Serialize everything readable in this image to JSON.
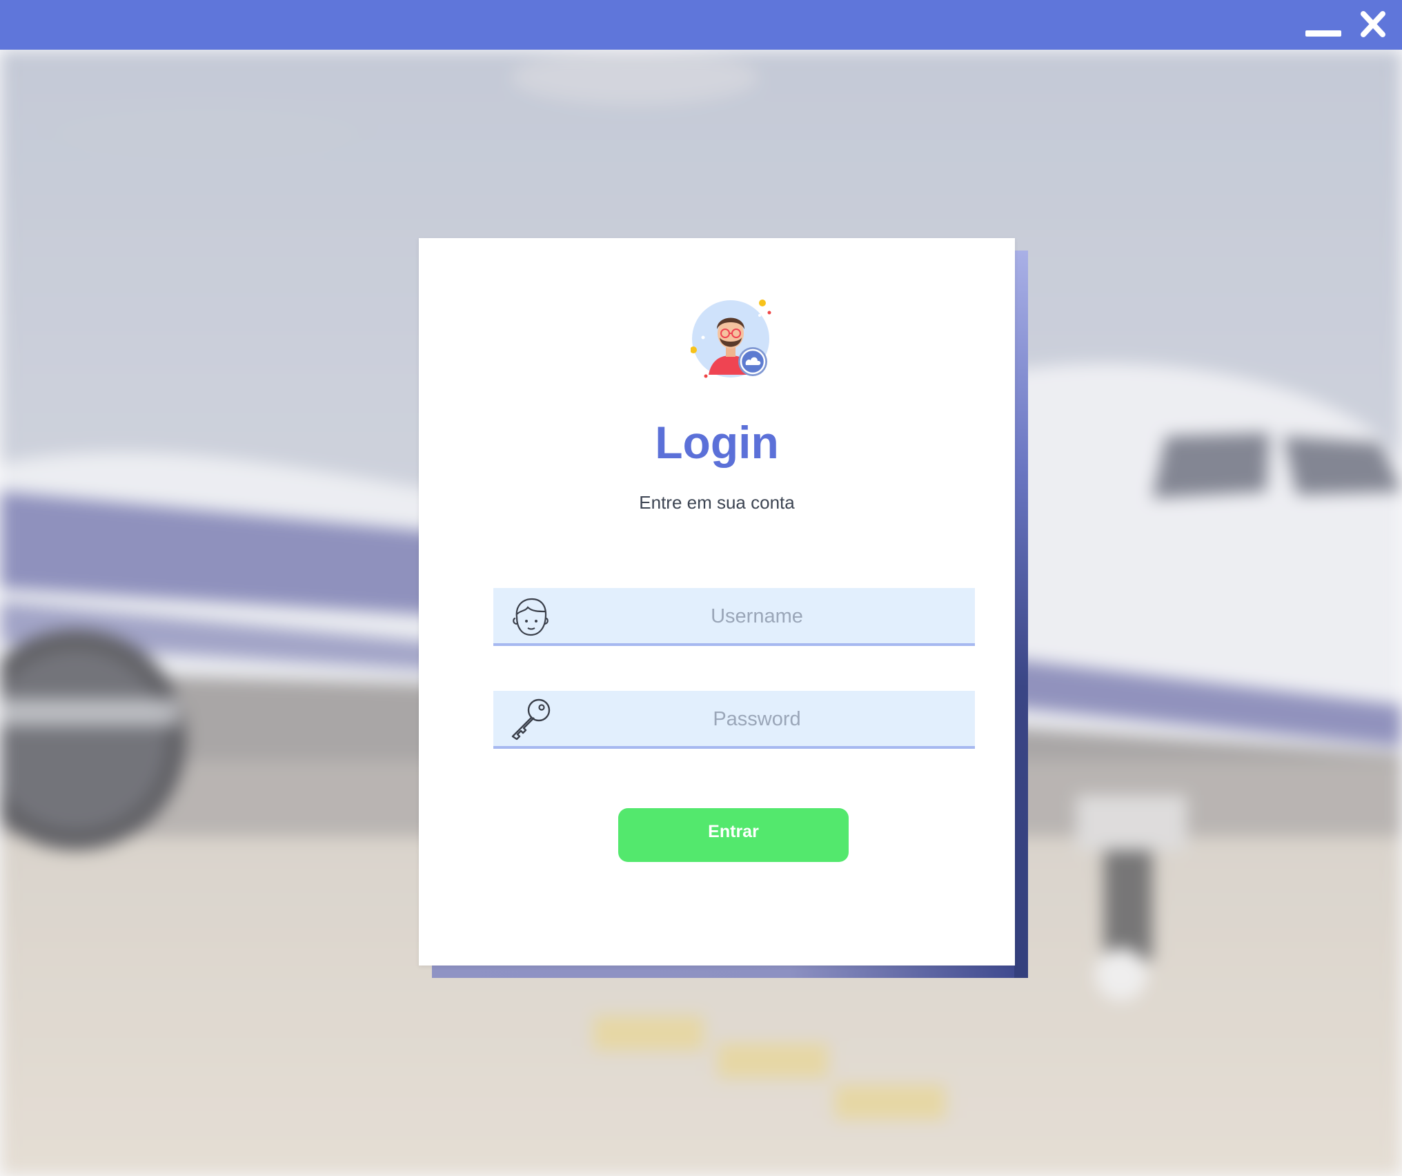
{
  "window": {
    "titlebar_color": "#5f76da",
    "minimize_icon": "minimize-icon",
    "close_icon": "close-icon"
  },
  "login": {
    "title": "Login",
    "subtitle": "Entre em sua conta",
    "avatar_icon": "user-avatar-illustration",
    "username": {
      "value": "",
      "placeholder": "Username",
      "icon": "user-face-icon"
    },
    "password": {
      "value": "",
      "placeholder": "Password",
      "icon": "key-icon"
    },
    "submit_label": "Entrar",
    "colors": {
      "accent": "#5b70d8",
      "button": "#53e86d",
      "field_background": "#e2effd",
      "field_underline": "#a6b8f0"
    }
  }
}
